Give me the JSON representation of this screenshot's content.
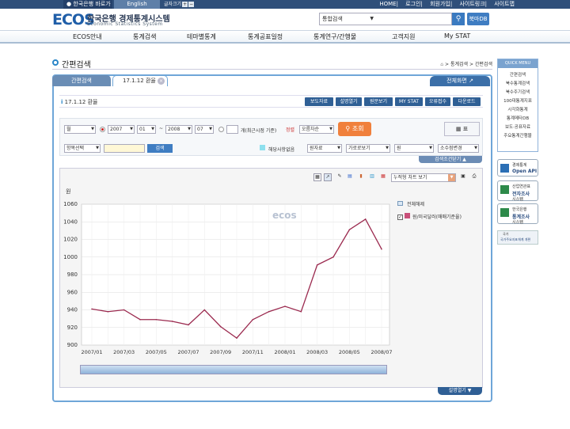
{
  "topbar": {
    "home_link": "한국은행 바로가기",
    "english": "English",
    "font_size_label": "글자크기",
    "font_plus": "+",
    "font_minus": "−",
    "util": [
      "HOME",
      "로그인",
      "회원가입",
      "사이트링크",
      "사이트맵"
    ]
  },
  "logo": {
    "ecos": "ECOS",
    "title_ko": "한국은행 경제통계시스템",
    "title_en": "Economic Statistics System"
  },
  "search": {
    "value": "통합검색",
    "button_icon": "search-icon",
    "db_button": "북마DB"
  },
  "nav": [
    "ECOS안내",
    "통계검색",
    "테마별통계",
    "통계공표일정",
    "통계연구/간행물",
    "고객지원",
    "My STAT"
  ],
  "page": {
    "title": "간편검색",
    "breadcrumb_sep": ">",
    "breadcrumb": [
      "통계검색",
      "간편검색"
    ]
  },
  "tabs": [
    {
      "label": "간편검색"
    },
    {
      "label": "17.1.12 환율",
      "close": "×"
    }
  ],
  "full_screen": "전체화면",
  "stat_name": {
    "bullet": "i",
    "label": "17.1.12 환율"
  },
  "action_buttons": [
    "보도자료",
    "설명열기",
    "원문보기",
    "MY STAT",
    "오류접수",
    "다운로드"
  ],
  "filter": {
    "cycle": "월",
    "start_year": "2007",
    "start_month": "01",
    "tilde": "~",
    "end_year": "2008",
    "end_month": "07",
    "recent_label": "개(최근시점 기준)",
    "sort_label": "정렬",
    "sort_value": "오름차순",
    "view_button": "조회",
    "table_button": "표",
    "item_select": "항목선택",
    "go_button": "검색",
    "no_data_label": "해당사항없음",
    "source_select": "원자료",
    "direction_select": "가로로보기",
    "unit_select": "원",
    "decimal_select": "소수점변경",
    "condition_button": "검색조건닫기"
  },
  "chart_toolbar": {
    "chart_type": "누적형 차트 보기"
  },
  "legend": {
    "header": "전체해제",
    "item": "원/미국달러(매매기준율)",
    "checked": "✓"
  },
  "watermark": "ecos",
  "description_button": "설명열기",
  "quick_menu": {
    "title": "QUICK MENU",
    "items": [
      "간편검색",
      "북수통계검색",
      "북수주기검색",
      "100대통계지표",
      "시각화통계",
      "통계메타DB",
      "보도·공표자료",
      "주요통계간행물"
    ]
  },
  "banners": [
    {
      "t1": "경제통계",
      "t2": "Open API"
    },
    {
      "t1": "산업연관표",
      "t2": "전자조사",
      "t3": "시스템"
    },
    {
      "t1": "한국은행",
      "t2": "통계조사",
      "t3": "시스템"
    }
  ],
  "nat_banner": {
    "t1": "국가",
    "t2": "국가주요지표체계 개편"
  },
  "chart_data": {
    "type": "line",
    "ylabel": "원",
    "xlabel": "",
    "ylim": [
      900,
      1060
    ],
    "yticks": [
      900,
      920,
      940,
      960,
      980,
      1000,
      1020,
      1040,
      1060
    ],
    "x": [
      "2007/01",
      "2007/02",
      "2007/03",
      "2007/04",
      "2007/05",
      "2007/06",
      "2007/07",
      "2007/08",
      "2007/09",
      "2007/10",
      "2007/11",
      "2007/12",
      "2008/01",
      "2008/02",
      "2008/03",
      "2008/04",
      "2008/05",
      "2008/06",
      "2008/07"
    ],
    "xtick_labels": [
      "2007/01",
      "2007/03",
      "2007/05",
      "2007/07",
      "2007/09",
      "2007/11",
      "2008/01",
      "2008/03",
      "2008/05",
      "2008/07"
    ],
    "series": [
      {
        "name": "원/미국달러(매매기준율)",
        "color": "#9b2a4f",
        "values": [
          941,
          938,
          940,
          929,
          929,
          927,
          923,
          940,
          921,
          908,
          929,
          938,
          944,
          938,
          991,
          1000,
          1031,
          1043,
          1009
        ]
      }
    ],
    "grid": true,
    "legend": "right"
  }
}
